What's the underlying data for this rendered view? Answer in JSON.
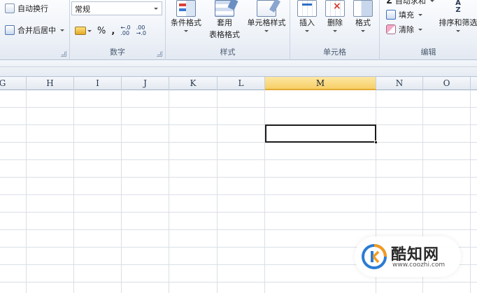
{
  "ribbon": {
    "alignment": {
      "wrap_text": "自动换行",
      "merge_center": "合并后居中"
    },
    "number": {
      "format_value": "常规",
      "percent": "%",
      "comma": ",",
      "increase_decimal": "←.0\n.00",
      "decrease_decimal": ".00\n→.0",
      "group_label": "数字"
    },
    "styles": {
      "conditional_format": "条件格式",
      "table_format_line1": "套用",
      "table_format_line2": "表格格式",
      "cell_styles": "单元格样式",
      "group_label": "样式"
    },
    "cells": {
      "insert": "插入",
      "delete": "删除",
      "format": "格式",
      "group_label": "单元格"
    },
    "editing": {
      "autosum": "自动求和",
      "fill": "填充",
      "clear": "清除",
      "sort_filter": "排序和筛选",
      "group_label": "编辑"
    }
  },
  "grid": {
    "columns": [
      "G",
      "H",
      "I",
      "J",
      "K",
      "L",
      "M",
      "N",
      "O"
    ],
    "active_column": "M"
  },
  "watermark": {
    "title": "酷知网",
    "url": "www.coozhi.com"
  },
  "colors": {
    "ribbon_bg": "#eef2f8",
    "active_header": "#f7cf66",
    "grid_line": "#dadfe6",
    "selection_border": "#1b1b1b",
    "watermark_orange": "#f39a1e",
    "watermark_blue": "#2b7cd3"
  }
}
